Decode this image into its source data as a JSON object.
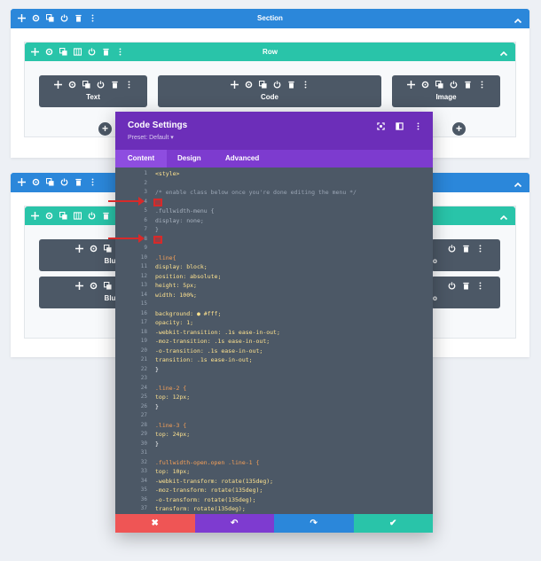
{
  "section1": {
    "title": "Section",
    "row": {
      "title": "Row",
      "modules": [
        {
          "label": "Text"
        },
        {
          "label": "Code"
        },
        {
          "label": "Image"
        }
      ]
    }
  },
  "section2": {
    "left_modules": [
      {
        "label": "Blu"
      },
      {
        "label": "Blu"
      }
    ],
    "right_modules": [
      {
        "label": "o"
      },
      {
        "label": "o"
      }
    ]
  },
  "modal": {
    "title": "Code Settings",
    "preset": "Preset: Default ▾",
    "tabs": [
      "Content",
      "Design",
      "Advanced"
    ],
    "active_tab": "Content",
    "footer": {
      "cancel": "✖",
      "undo": "↶",
      "redo": "↷",
      "save": "✔"
    },
    "colors": {
      "header": "#6c2eb9",
      "tabs": "#7d3bcf",
      "cancel": "#ef5555",
      "undo": "#7e3bd0",
      "redo": "#2b87da",
      "save": "#29c4a9"
    }
  },
  "code": {
    "line_numbers": [
      "1",
      "2",
      "3",
      "4",
      "5",
      "6",
      "7",
      "8",
      "9",
      "10",
      "11",
      "12",
      "13",
      "14",
      "15",
      "16",
      "17",
      "18",
      "19",
      "20",
      "21",
      "22",
      "23",
      "24",
      "25",
      "26",
      "27",
      "28",
      "29",
      "30",
      "31",
      "32",
      "33",
      "34",
      "35",
      "36",
      "37"
    ],
    "lines": [
      "<style>",
      "",
      "/* enable class below once you're done editing the menu */",
      "",
      ".fullwidth-menu {",
      "display: none;",
      "}",
      "",
      "",
      ".line{",
      "display: block;",
      "position: absolute;",
      "height: 5px;",
      "width: 100%;",
      "",
      "background: ● #fff;",
      "opacity: 1;",
      "-webkit-transition: .1s ease-in-out;",
      "-moz-transition: .1s ease-in-out;",
      "-o-transition: .1s ease-in-out;",
      "transition: .1s ease-in-out;",
      "}",
      "",
      ".line-2 {",
      "top: 12px;",
      "}",
      "",
      ".line-3 {",
      "top: 24px;",
      "}",
      "",
      ".fullwidth-open.open .line-1 {",
      "top: 10px;",
      "-webkit-transform: rotate(135deg);",
      "-moz-transform: rotate(135deg);",
      "-o-transform: rotate(135deg);",
      "transform: rotate(135deg);"
    ]
  }
}
